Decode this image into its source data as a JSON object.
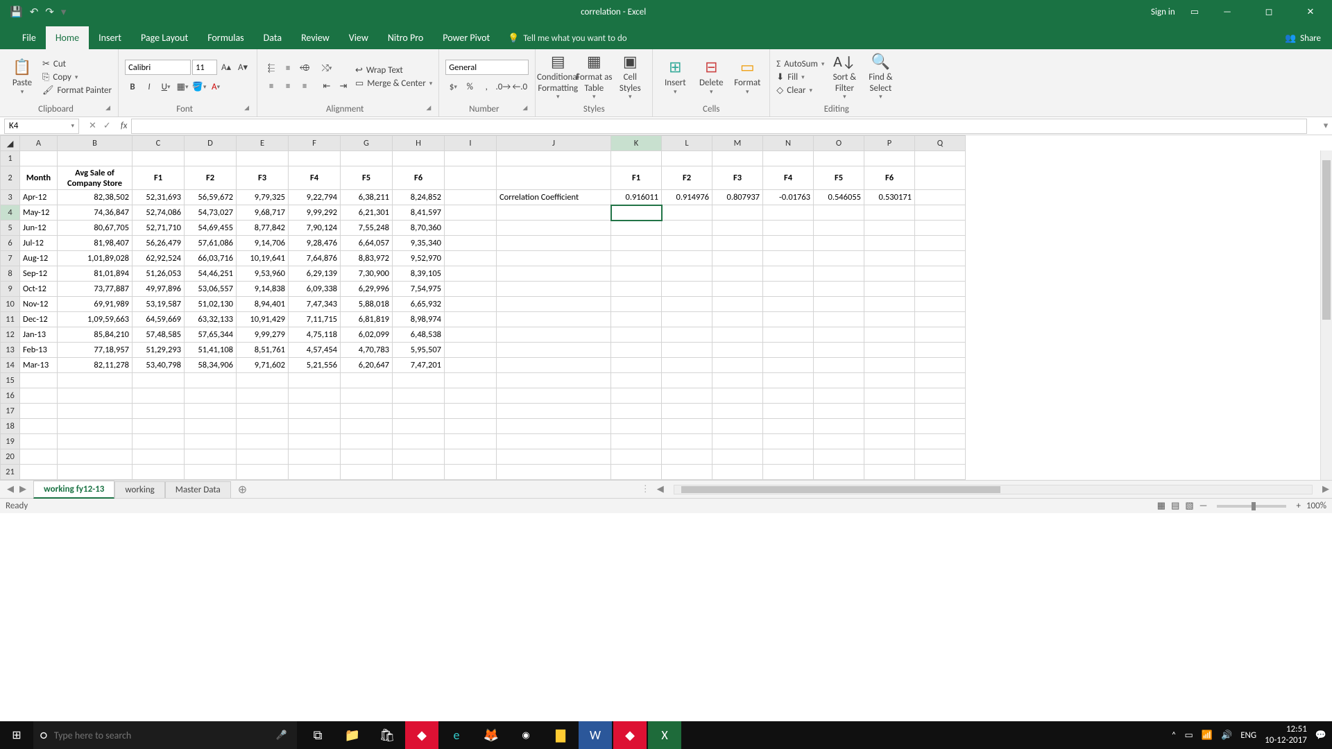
{
  "title": "correlation  -  Excel",
  "signin": "Sign in",
  "tabs": [
    "File",
    "Home",
    "Insert",
    "Page Layout",
    "Formulas",
    "Data",
    "Review",
    "View",
    "Nitro Pro",
    "Power Pivot"
  ],
  "active_tab": "Home",
  "tellme": "Tell me what you want to do",
  "share": "Share",
  "clipboard": {
    "paste": "Paste",
    "cut": "Cut",
    "copy": "Copy",
    "painter": "Format Painter",
    "label": "Clipboard"
  },
  "font": {
    "name": "Calibri",
    "size": "11",
    "label": "Font"
  },
  "alignment": {
    "wrap": "Wrap Text",
    "merge": "Merge & Center",
    "label": "Alignment"
  },
  "number": {
    "format": "General",
    "label": "Number"
  },
  "styles": {
    "cond": "Conditional Formatting",
    "fmt": "Format as Table",
    "cell": "Cell Styles",
    "label": "Styles"
  },
  "cells": {
    "insert": "Insert",
    "delete": "Delete",
    "format": "Format",
    "label": "Cells"
  },
  "editing": {
    "autosum": "AutoSum",
    "fill": "Fill",
    "clear": "Clear",
    "sort": "Sort & Filter",
    "find": "Find & Select",
    "label": "Editing"
  },
  "namebox": "K4",
  "formula": "",
  "cols": [
    "A",
    "B",
    "C",
    "D",
    "E",
    "F",
    "G",
    "H",
    "I",
    "J",
    "K",
    "L",
    "M",
    "N",
    "O",
    "P",
    "Q"
  ],
  "headers": {
    "month": "Month",
    "avg": "Avg Sale of Company Store",
    "f": [
      "F1",
      "F2",
      "F3",
      "F4",
      "F5",
      "F6"
    ],
    "corr": "Correlation Coefficient"
  },
  "rows": [
    {
      "m": "Apr-12",
      "a": "82,38,502",
      "v": [
        "52,31,693",
        "56,59,672",
        "9,79,325",
        "9,22,794",
        "6,38,211",
        "8,24,852"
      ]
    },
    {
      "m": "May-12",
      "a": "74,36,847",
      "v": [
        "52,74,086",
        "54,73,027",
        "9,68,717",
        "9,99,292",
        "6,21,301",
        "8,41,597"
      ]
    },
    {
      "m": "Jun-12",
      "a": "80,67,705",
      "v": [
        "52,71,710",
        "54,69,455",
        "8,77,842",
        "7,90,124",
        "7,55,248",
        "8,70,360"
      ]
    },
    {
      "m": "Jul-12",
      "a": "81,98,407",
      "v": [
        "56,26,479",
        "57,61,086",
        "9,14,706",
        "9,28,476",
        "6,64,057",
        "9,35,340"
      ]
    },
    {
      "m": "Aug-12",
      "a": "1,01,89,028",
      "v": [
        "62,92,524",
        "66,03,716",
        "10,19,641",
        "7,64,876",
        "8,83,972",
        "9,52,970"
      ]
    },
    {
      "m": "Sep-12",
      "a": "81,01,894",
      "v": [
        "51,26,053",
        "54,46,251",
        "9,53,960",
        "6,29,139",
        "7,30,900",
        "8,39,105"
      ]
    },
    {
      "m": "Oct-12",
      "a": "73,77,887",
      "v": [
        "49,97,896",
        "53,06,557",
        "9,14,838",
        "6,09,338",
        "6,29,996",
        "7,54,975"
      ]
    },
    {
      "m": "Nov-12",
      "a": "69,91,989",
      "v": [
        "53,19,587",
        "51,02,130",
        "8,94,401",
        "7,47,343",
        "5,88,018",
        "6,65,932"
      ]
    },
    {
      "m": "Dec-12",
      "a": "1,09,59,663",
      "v": [
        "64,59,669",
        "63,32,133",
        "10,91,429",
        "7,11,715",
        "6,81,819",
        "8,98,974"
      ]
    },
    {
      "m": "Jan-13",
      "a": "85,84,210",
      "v": [
        "57,48,585",
        "57,65,344",
        "9,99,279",
        "4,75,118",
        "6,02,099",
        "6,48,538"
      ]
    },
    {
      "m": "Feb-13",
      "a": "77,18,957",
      "v": [
        "51,29,293",
        "51,41,108",
        "8,51,761",
        "4,57,454",
        "4,70,783",
        "5,95,507"
      ]
    },
    {
      "m": "Mar-13",
      "a": "82,11,278",
      "v": [
        "53,40,798",
        "58,34,906",
        "9,71,602",
        "5,21,556",
        "6,20,647",
        "7,47,201"
      ]
    }
  ],
  "corr": [
    "0.916011",
    "0.914976",
    "0.807937",
    "-0.01763",
    "0.546055",
    "0.530171"
  ],
  "sheets": [
    "working fy12-13",
    "working",
    "Master Data"
  ],
  "active_sheet": "working fy12-13",
  "status": "Ready",
  "zoom": "100%",
  "taskbar": {
    "search": "Type here to search",
    "lang": "ENG",
    "time": "12:51",
    "date": "10-12-2017"
  }
}
